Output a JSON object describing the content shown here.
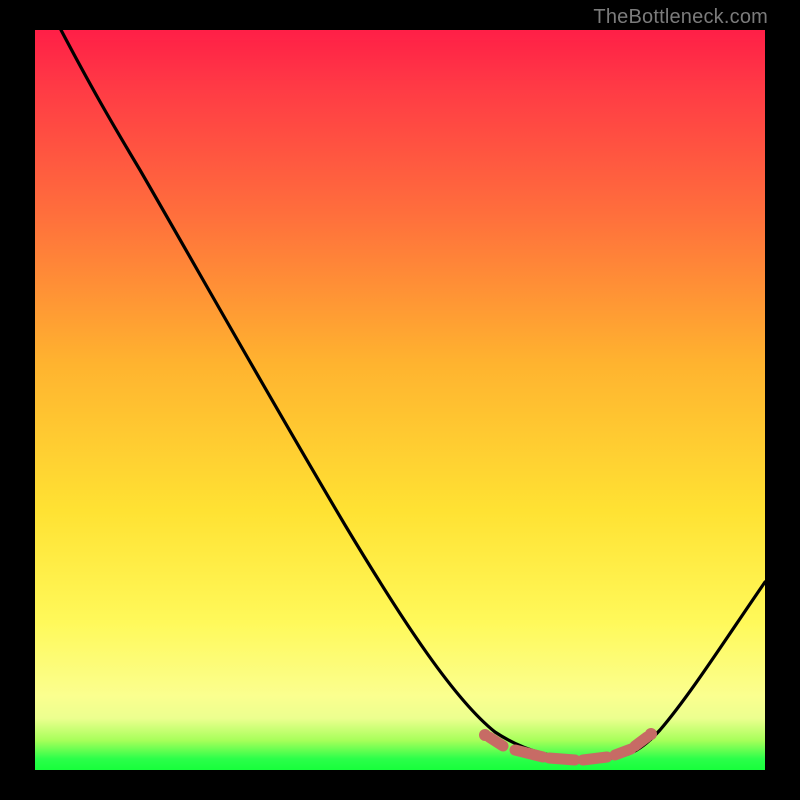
{
  "watermark": "TheBottleneck.com",
  "chart_data": {
    "type": "line",
    "title": "",
    "xlabel": "",
    "ylabel": "",
    "ylim": [
      0,
      100
    ],
    "series": [
      {
        "name": "bottleneck-curve",
        "x": [
          0.0,
          0.05,
          0.1,
          0.15,
          0.2,
          0.25,
          0.3,
          0.35,
          0.4,
          0.45,
          0.5,
          0.55,
          0.6,
          0.65,
          0.7,
          0.75,
          0.8,
          0.85,
          0.9,
          0.95,
          1.0
        ],
        "values": [
          100,
          95,
          88,
          80,
          72,
          64,
          56,
          48,
          40,
          32,
          24,
          16,
          9,
          4,
          1,
          0,
          0,
          2,
          7,
          14,
          23
        ]
      },
      {
        "name": "optimal-zone-markers",
        "x": [
          0.62,
          0.66,
          0.68,
          0.72,
          0.74,
          0.8,
          0.82
        ],
        "values": [
          3.5,
          2.0,
          1.5,
          0.8,
          0.6,
          0.6,
          1.5
        ]
      }
    ],
    "colors": {
      "curve": "#000000",
      "markers": "#c46a64"
    }
  }
}
